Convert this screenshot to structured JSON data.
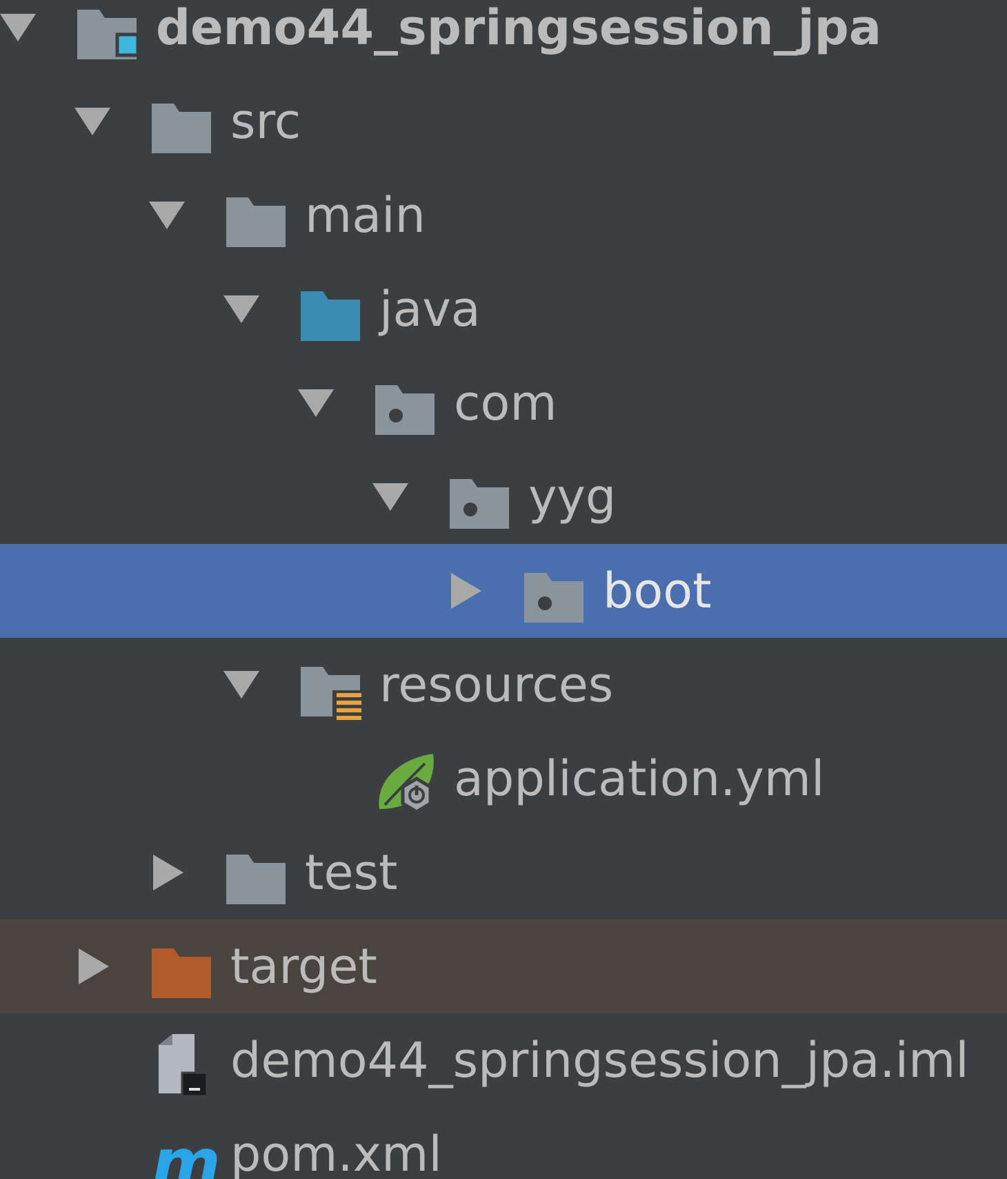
{
  "project_tree": {
    "items": [
      {
        "label": "demo44_springsession_jpa",
        "kind": "module",
        "expanded": true,
        "bold": true
      },
      {
        "label": "src",
        "kind": "folder",
        "expanded": true
      },
      {
        "label": "main",
        "kind": "folder",
        "expanded": true
      },
      {
        "label": "java",
        "kind": "source-root",
        "expanded": true
      },
      {
        "label": "com",
        "kind": "package",
        "expanded": true
      },
      {
        "label": "yyg",
        "kind": "package",
        "expanded": true
      },
      {
        "label": "boot",
        "kind": "package",
        "expanded": false,
        "selected": true
      },
      {
        "label": "resources",
        "kind": "resources-root",
        "expanded": true
      },
      {
        "label": "application.yml",
        "kind": "spring-yml"
      },
      {
        "label": "test",
        "kind": "folder",
        "expanded": false
      },
      {
        "label": "target",
        "kind": "excluded-folder",
        "expanded": false,
        "excluded": true
      },
      {
        "label": "demo44_springsession_jpa.iml",
        "kind": "iml-file"
      },
      {
        "label": "pom.xml",
        "kind": "maven-file"
      }
    ]
  },
  "colors": {
    "background": "#3c3f41",
    "selection": "#4b6eaf",
    "excluded_row": "#49453e",
    "text": "#bbbbbb",
    "folder": "#8a949c",
    "source_folder": "#3b8cb3",
    "excluded_folder": "#b35a2b",
    "module_badge": "#40b6e0",
    "resources_badge": "#e8a33d",
    "spring_leaf": "#6aab3f",
    "maven_m": "#2aa5e8"
  }
}
